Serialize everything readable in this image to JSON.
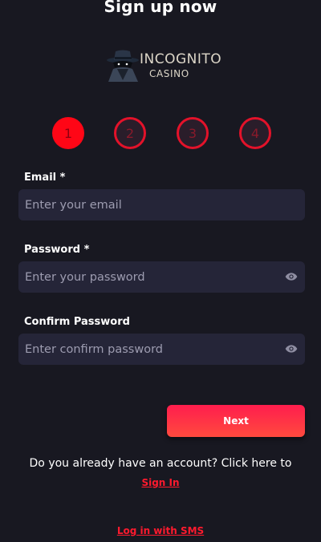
{
  "page": {
    "title": "Sign up now"
  },
  "logo": {
    "line1": "INCOGNITO",
    "line2": "CASINO"
  },
  "steps": [
    "1",
    "2",
    "3",
    "4"
  ],
  "form": {
    "email": {
      "label": "Email *",
      "placeholder": "Enter your email"
    },
    "password": {
      "label": "Password *",
      "placeholder": "Enter your password"
    },
    "confirm": {
      "label": "Confirm Password",
      "placeholder": "Enter confirm password"
    }
  },
  "actions": {
    "next_label": "Next",
    "account_prompt": "Do you already have an account? Click here to",
    "sign_in_label": "Sign In",
    "sms_label": "Log in with SMS"
  },
  "colors": {
    "background": "#181821",
    "field_bg": "#252538",
    "accent": "#ff0616"
  },
  "icons": {
    "password_toggle": "eye-icon",
    "confirm_toggle": "eye-icon"
  }
}
